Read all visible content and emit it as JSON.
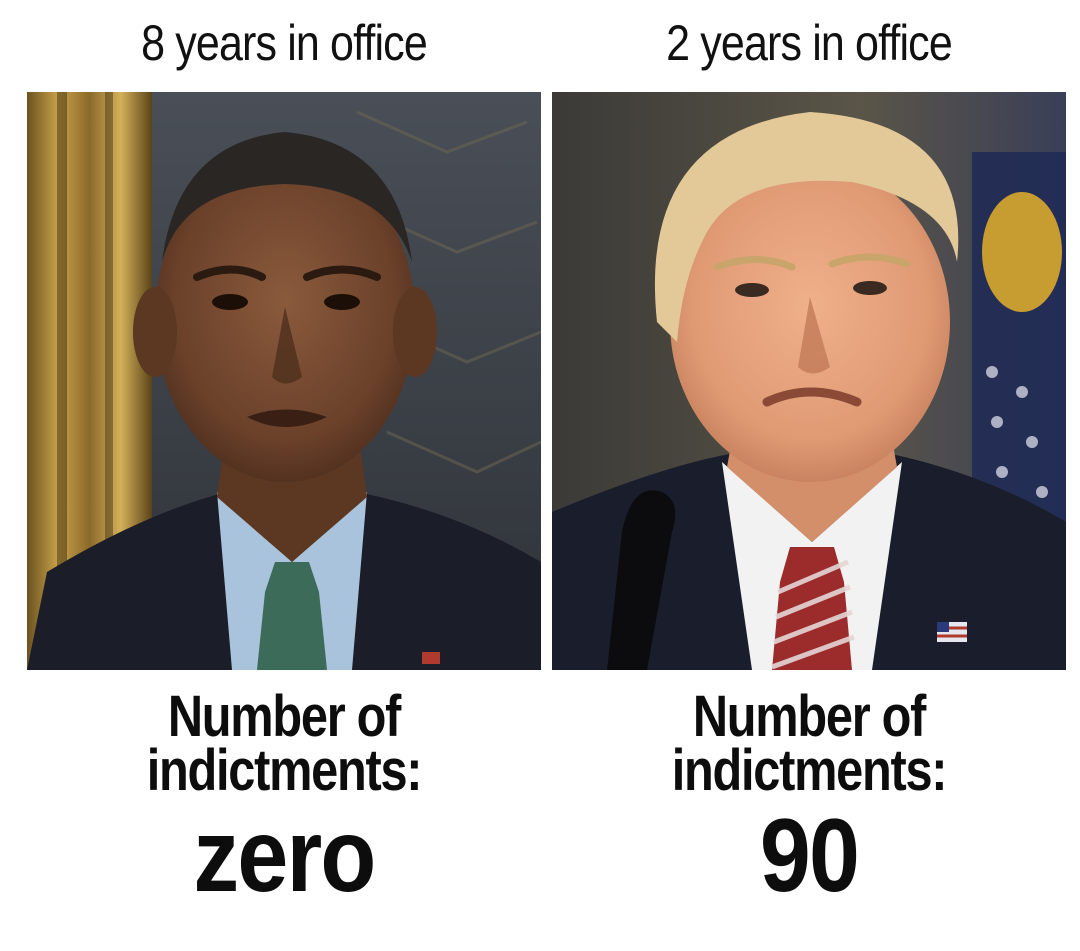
{
  "panels": [
    {
      "header": "8 years in office",
      "caption_line1": "Number of",
      "caption_line2": "indictments:",
      "count": "zero"
    },
    {
      "header": "2 years in office",
      "caption_line1": "Number of",
      "caption_line2": "indictments:",
      "count": "90"
    }
  ],
  "colors": {
    "background": "#ffffff",
    "text": "#111111"
  }
}
